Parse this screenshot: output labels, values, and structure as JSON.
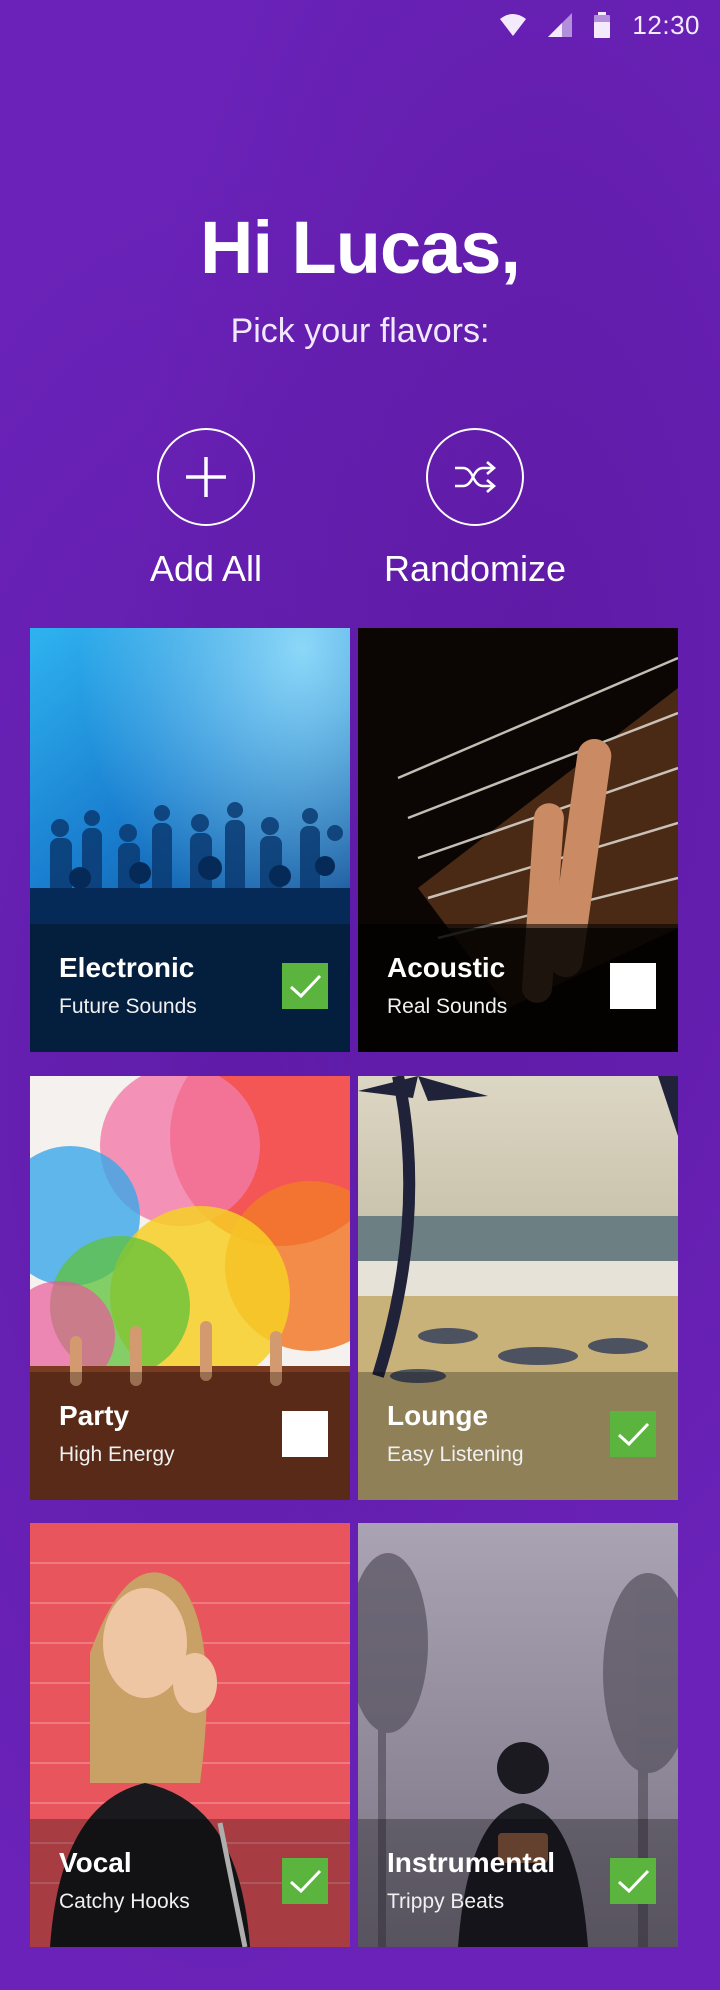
{
  "status_bar": {
    "time": "12:30",
    "icons": [
      "wifi-icon",
      "signal-icon",
      "battery-icon"
    ]
  },
  "header": {
    "greeting": "Hi Lucas,",
    "subtitle": "Pick your flavors:"
  },
  "actions": [
    {
      "label": "Add All",
      "icon": "plus-icon"
    },
    {
      "label": "Randomize",
      "icon": "shuffle-icon"
    }
  ],
  "flavors": [
    {
      "title": "Electronic",
      "subtitle": "Future Sounds",
      "selected": true
    },
    {
      "title": "Acoustic",
      "subtitle": "Real Sounds",
      "selected": false
    },
    {
      "title": "Party",
      "subtitle": "High Energy",
      "selected": false
    },
    {
      "title": "Lounge",
      "subtitle": "Easy Listening",
      "selected": true
    },
    {
      "title": "Vocal",
      "subtitle": "Catchy Hooks",
      "selected": true
    },
    {
      "title": "Instrumental",
      "subtitle": "Trippy Beats",
      "selected": true
    }
  ],
  "colors": {
    "background": "#6a22b8",
    "checkbox_on": "#5ab43e",
    "checkbox_off": "#ffffff",
    "text": "#ffffff"
  }
}
